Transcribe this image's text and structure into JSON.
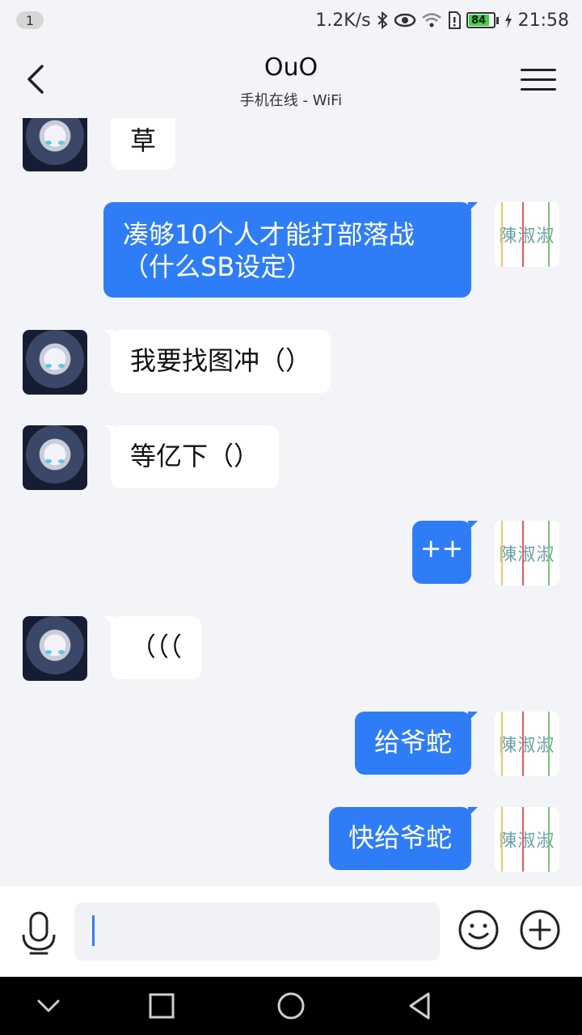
{
  "status_bar": {
    "notification_count": "1",
    "net_speed": "1.2K/s",
    "battery_level": "84",
    "time": "21:58",
    "icons": [
      "bluetooth-icon",
      "eye-icon",
      "wifi-icon",
      "sim-icon",
      "battery-icon",
      "charging-icon"
    ]
  },
  "header": {
    "title": "OuO",
    "subtitle": "手机在线 - WiFi"
  },
  "messages": [
    {
      "side": "in",
      "text": "草"
    },
    {
      "side": "out",
      "text": "凑够10个人才能打部落战",
      "text2": "（什么SB设定）"
    },
    {
      "side": "in",
      "text": "我要找图冲（）"
    },
    {
      "side": "in",
      "text": "等亿下（）"
    },
    {
      "side": "out",
      "text": "++"
    },
    {
      "side": "in",
      "text": "（（（"
    },
    {
      "side": "out",
      "text": "给爷蛇"
    },
    {
      "side": "out",
      "text": "快给爷蛇"
    }
  ],
  "input": {
    "value": "",
    "placeholder": ""
  },
  "colors": {
    "accent": "#2f7df6",
    "background": "#f3f4f8",
    "bubble_in": "#ffffff"
  }
}
